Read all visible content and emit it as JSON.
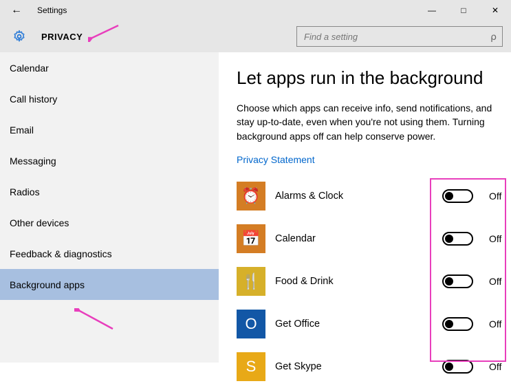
{
  "titlebar": {
    "title": "Settings"
  },
  "header": {
    "section": "PRIVACY",
    "search_placeholder": "Find a setting"
  },
  "sidebar": {
    "items": [
      {
        "label": "Calendar",
        "selected": false
      },
      {
        "label": "Call history",
        "selected": false
      },
      {
        "label": "Email",
        "selected": false
      },
      {
        "label": "Messaging",
        "selected": false
      },
      {
        "label": "Radios",
        "selected": false
      },
      {
        "label": "Other devices",
        "selected": false
      },
      {
        "label": "Feedback & diagnostics",
        "selected": false
      },
      {
        "label": "Background apps",
        "selected": true
      }
    ]
  },
  "main": {
    "title": "Let apps run in the background",
    "description": "Choose which apps can receive info, send notifications, and stay up-to-date, even when you're not using them. Turning background apps off can help conserve power.",
    "privacy_link": "Privacy Statement",
    "apps": [
      {
        "name": "Alarms & Clock",
        "state": "Off",
        "icon": "alarm",
        "bg": "#d47d24"
      },
      {
        "name": "Calendar",
        "state": "Off",
        "icon": "calendar",
        "bg": "#d47d24"
      },
      {
        "name": "Food & Drink",
        "state": "Off",
        "icon": "food",
        "bg": "#d6b02a"
      },
      {
        "name": "Get Office",
        "state": "Off",
        "icon": "office",
        "bg": "#1257a6"
      },
      {
        "name": "Get Skype",
        "state": "Off",
        "icon": "skype",
        "bg": "#e8a917"
      }
    ]
  },
  "icons": {
    "alarm": "⏰",
    "calendar": "📅",
    "food": "🍴",
    "office": "O",
    "skype": "S"
  }
}
